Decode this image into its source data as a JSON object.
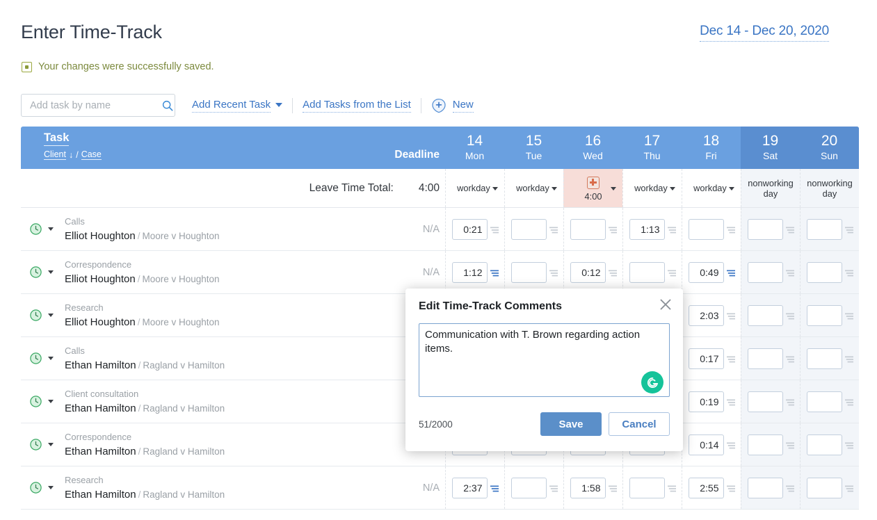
{
  "header": {
    "title": "Enter Time-Track",
    "date_range": "Dec 14 - Dec 20, 2020"
  },
  "notice": {
    "icon": "saved-check-icon",
    "text": "Your changes were successfully saved."
  },
  "toolbar": {
    "search_placeholder": "Add task by name",
    "search_value": "",
    "search_icon": "search-icon",
    "add_recent_task": "Add Recent Task",
    "add_tasks_from_list": "Add Tasks from the List",
    "new_label": "New",
    "new_icon": "plus-circle-icon"
  },
  "table": {
    "task_header": "Task",
    "client_header": "Client",
    "sort_arrow": "↓",
    "separator": "/",
    "case_header": "Case",
    "deadline_header": "Deadline",
    "leave_time_total_label": "Leave Time Total:",
    "leave_time_total_value": "4:00",
    "days": [
      {
        "num": "14",
        "name": "Mon",
        "weekend": false,
        "type": "workday",
        "type_value": ""
      },
      {
        "num": "15",
        "name": "Tue",
        "weekend": false,
        "type": "workday",
        "type_value": ""
      },
      {
        "num": "16",
        "name": "Wed",
        "weekend": false,
        "type": "sick",
        "type_value": "4:00"
      },
      {
        "num": "17",
        "name": "Thu",
        "weekend": false,
        "type": "workday",
        "type_value": ""
      },
      {
        "num": "18",
        "name": "Fri",
        "weekend": false,
        "type": "workday",
        "type_value": ""
      },
      {
        "num": "19",
        "name": "Sat",
        "weekend": true,
        "type": "nonworking day",
        "type_value": ""
      },
      {
        "num": "20",
        "name": "Sun",
        "weekend": true,
        "type": "nonworking day",
        "type_value": ""
      }
    ],
    "workday_label": "workday",
    "nonworking_label": "nonworking day",
    "rows": [
      {
        "task_type": "Calls",
        "client": "Elliot Houghton",
        "case": "Moore v Houghton",
        "deadline": "N/A",
        "times": [
          "0:21",
          "",
          "",
          "1:13",
          "",
          "",
          ""
        ],
        "has_comment": [
          false,
          false,
          false,
          false,
          false,
          false,
          false
        ]
      },
      {
        "task_type": "Correspondence",
        "client": "Elliot Houghton",
        "case": "Moore v Houghton",
        "deadline": "N/A",
        "times": [
          "1:12",
          "",
          "0:12",
          "",
          "0:49",
          "",
          ""
        ],
        "has_comment": [
          true,
          false,
          false,
          false,
          true,
          false,
          false
        ]
      },
      {
        "task_type": "Research",
        "client": "Elliot Houghton",
        "case": "Moore v Houghton",
        "deadline": "N/A",
        "times": [
          "",
          "",
          "",
          "",
          "2:03",
          "",
          ""
        ],
        "has_comment": [
          false,
          false,
          false,
          false,
          false,
          false,
          false
        ]
      },
      {
        "task_type": "Calls",
        "client": "Ethan Hamilton",
        "case": "Ragland v Hamilton",
        "deadline": "",
        "times": [
          "",
          "",
          "",
          "",
          "0:17",
          "",
          ""
        ],
        "has_comment": [
          false,
          false,
          false,
          false,
          false,
          false,
          false
        ]
      },
      {
        "task_type": "Client consultation",
        "client": "Ethan Hamilton",
        "case": "Ragland v Hamilton",
        "deadline": "",
        "times": [
          "",
          "",
          "",
          "",
          "0:19",
          "",
          ""
        ],
        "has_comment": [
          false,
          false,
          false,
          false,
          false,
          false,
          false
        ]
      },
      {
        "task_type": "Correspondence",
        "client": "Ethan Hamilton",
        "case": "Ragland v Hamilton",
        "deadline": "",
        "times": [
          "",
          "",
          "",
          "",
          "0:14",
          "",
          ""
        ],
        "has_comment": [
          false,
          false,
          false,
          false,
          false,
          false,
          false
        ]
      },
      {
        "task_type": "Research",
        "client": "Ethan Hamilton",
        "case": "Ragland v Hamilton",
        "deadline": "N/A",
        "times": [
          "2:37",
          "",
          "1:58",
          "",
          "2:55",
          "",
          ""
        ],
        "has_comment": [
          true,
          false,
          false,
          false,
          false,
          false,
          false
        ]
      }
    ]
  },
  "modal": {
    "title": "Edit Time-Track Comments",
    "close_icon": "close-icon",
    "comment_text": "Communication with T. Brown regarding action items.",
    "grammarly_icon": "grammarly-icon",
    "char_count": "51/2000",
    "save_label": "Save",
    "cancel_label": "Cancel"
  },
  "colors": {
    "header_blue": "#6aa0e0",
    "weekend_blue": "#5a8ed0",
    "link_blue": "#3a75c4",
    "title_dark": "#333d4d",
    "success_green": "#7c8a3e",
    "sick_bg": "#f7ddd8",
    "save_btn": "#5b8fc9",
    "grammarly_green": "#15c39a"
  }
}
